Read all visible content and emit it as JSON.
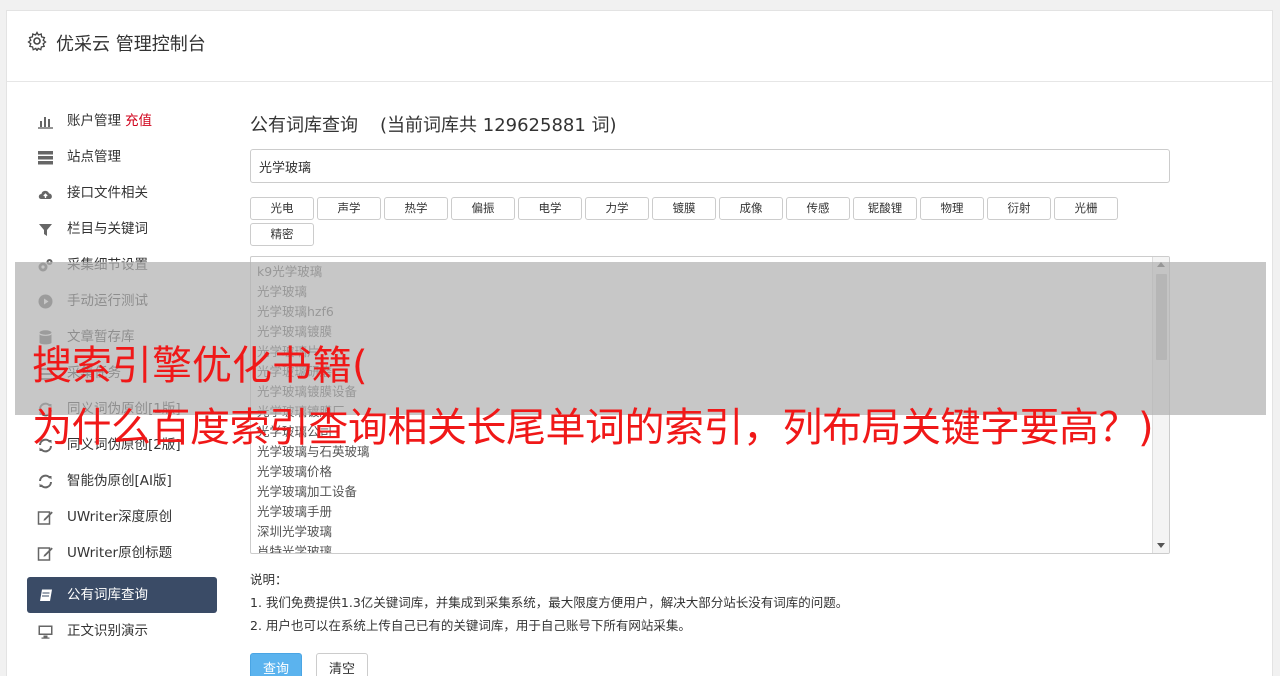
{
  "header": {
    "title": "优采云 管理控制台",
    "icon": "gear-icon"
  },
  "sidebar": {
    "items": [
      {
        "label": "账户管理",
        "extra": "充值",
        "icon": "bar-chart-icon"
      },
      {
        "label": "站点管理",
        "icon": "server-icon"
      },
      {
        "label": "接口文件相关",
        "icon": "cloud-upload-icon"
      },
      {
        "label": "栏目与关键词",
        "icon": "filter-icon"
      },
      {
        "label": "采集细节设置",
        "icon": "gears-icon"
      },
      {
        "label": "手动运行测试",
        "icon": "play-circle-icon"
      },
      {
        "label": "文章暂存库",
        "icon": "database-icon"
      },
      {
        "label": "采集任务",
        "icon": "tasks-icon"
      },
      {
        "label": "同义词伪原创[1版]",
        "icon": "refresh-icon"
      },
      {
        "label": "同义词伪原创[2版]",
        "icon": "refresh-icon"
      },
      {
        "label": "智能伪原创[AI版]",
        "icon": "refresh-icon"
      },
      {
        "label": "UWriter深度原创",
        "icon": "edit-icon"
      },
      {
        "label": "UWriter原创标题",
        "icon": "edit-icon"
      },
      {
        "label": "公有词库查询",
        "icon": "book-icon",
        "active": true
      },
      {
        "label": "正文识别演示",
        "icon": "monitor-icon"
      }
    ]
  },
  "main": {
    "title": "公有词库查询",
    "subtitle": "(当前词库共 129625881 词)",
    "search_value": "光学玻璃",
    "tags": [
      "光电",
      "声学",
      "热学",
      "偏振",
      "电学",
      "力学",
      "镀膜",
      "成像",
      "传感",
      "铌酸锂",
      "物理",
      "衍射",
      "光栅",
      "精密"
    ],
    "results": [
      "k9光学玻璃",
      "光学玻璃",
      "光学玻璃hzf6",
      "光学玻璃镀膜",
      "光学玻璃片",
      "光学玻璃研磨",
      "光学玻璃镀膜设备",
      "光学玻璃镀膜厂",
      "光学玻璃公司",
      "光学玻璃与石英玻璃",
      "光学玻璃价格",
      "光学玻璃加工设备",
      "光学玻璃手册",
      "深圳光学玻璃",
      "肖特光学玻璃"
    ],
    "notes_title": "说明：",
    "notes": [
      "1. 我们免费提供1.3亿关键词库，并集成到采集系统，最大限度方便用户，解决大部分站长没有词库的问题。",
      "2. 用户也可以在系统上传自己已有的关键词库，用于自己账号下所有网站采集。"
    ],
    "query_button": "查询",
    "clear_button": "清空"
  },
  "overlay": {
    "line1": "搜索引擎优化书籍(",
    "line2": "为什么百度索引查询相关长尾单词的索引，列布局关键字要高？)"
  },
  "colors": {
    "accent": "#5bb3ee",
    "active_nav": "#3a4b66",
    "overlay_text": "#f01818",
    "recharge": "#d0021b"
  }
}
